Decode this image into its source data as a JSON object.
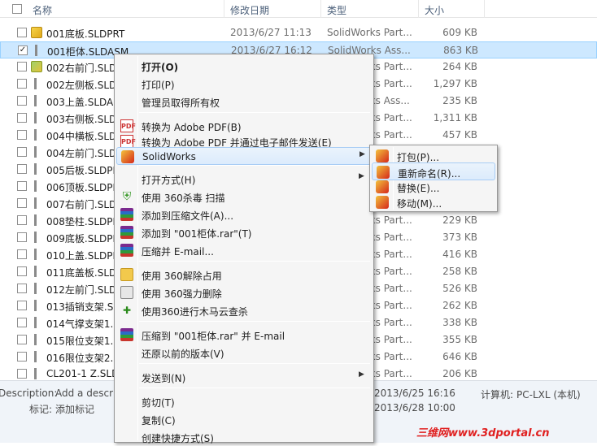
{
  "header": {
    "name": "名称",
    "date": "修改日期",
    "type": "类型",
    "size": "大小"
  },
  "files": [
    {
      "name": "001底板.SLDPRT",
      "date": "2013/6/27 11:13",
      "type": "SolidWorks Part...",
      "size": "609 KB",
      "icon": "part-icon"
    },
    {
      "name": "001柜体.SLDASM",
      "date": "2013/6/27 16:12",
      "type": "SolidWorks Ass...",
      "size": "863 KB",
      "icon": "drawing-icon",
      "selected": true,
      "check": "✓"
    },
    {
      "name": "002右前门.SLD",
      "date": "",
      "type": "SolidWorks Part...",
      "size": "264 KB",
      "icon": "assembly-icon"
    },
    {
      "name": "002左侧板.SLD",
      "date": "",
      "type": "SolidWorks Part...",
      "size": "1,297 KB",
      "icon": "drawing-icon"
    },
    {
      "name": "003上盖.SLDAS",
      "date": "",
      "type": "SolidWorks Ass...",
      "size": "235 KB",
      "icon": "drawing-icon"
    },
    {
      "name": "003右侧板.SLD",
      "date": "",
      "type": "SolidWorks Part...",
      "size": "1,311 KB",
      "icon": "drawing-icon"
    },
    {
      "name": "004中横板.SLD",
      "date": "",
      "type": "SolidWorks Part...",
      "size": "457 KB",
      "icon": "drawing-icon"
    },
    {
      "name": "004左前门.SLD",
      "date": "",
      "type": "",
      "size": "",
      "icon": "drawing-icon"
    },
    {
      "name": "005后板.SLDPF",
      "date": "",
      "type": "",
      "size": "",
      "icon": "drawing-icon"
    },
    {
      "name": "006顶板.SLDPF",
      "date": "",
      "type": "",
      "size": "",
      "icon": "drawing-icon"
    },
    {
      "name": "007右前门.SLD",
      "date": "",
      "type": "",
      "size": "",
      "icon": "drawing-icon"
    },
    {
      "name": "008垫柱.SLDPF",
      "date": "",
      "type": "SolidWorks Part...",
      "size": "229 KB",
      "icon": "drawing-icon"
    },
    {
      "name": "009底板.SLDPF",
      "date": "",
      "type": "SolidWorks Part...",
      "size": "373 KB",
      "icon": "drawing-icon"
    },
    {
      "name": "010上盖.SLDPF",
      "date": "",
      "type": "SolidWorks Part...",
      "size": "416 KB",
      "icon": "drawing-icon"
    },
    {
      "name": "011底盖板.SLD",
      "date": "",
      "type": "SolidWorks Part...",
      "size": "258 KB",
      "icon": "drawing-icon"
    },
    {
      "name": "012左前门.SLD",
      "date": "",
      "type": "SolidWorks Part...",
      "size": "526 KB",
      "icon": "drawing-icon"
    },
    {
      "name": "013插销支架.SL",
      "date": "",
      "type": "SolidWorks Part...",
      "size": "262 KB",
      "icon": "drawing-icon"
    },
    {
      "name": "014气撑支架1.S",
      "date": "",
      "type": "SolidWorks Part...",
      "size": "338 KB",
      "icon": "drawing-icon"
    },
    {
      "name": "015限位支架1.S",
      "date": "",
      "type": "SolidWorks Part...",
      "size": "355 KB",
      "icon": "drawing-icon"
    },
    {
      "name": "016限位支架2.S",
      "date": "",
      "type": "SolidWorks Part...",
      "size": "646 KB",
      "icon": "drawing-icon"
    },
    {
      "name": "CL201-1 Z.SLD",
      "date": "",
      "type": "SolidWorks Part...",
      "size": "206 KB",
      "icon": "drawing-icon"
    }
  ],
  "status": {
    "description_label": "Description:",
    "description_value": "Add a descr",
    "tags_label": "标记:",
    "tags_value": "添加标记",
    "date1": "2013/6/25 16:16",
    "date2": "2013/6/28 10:00",
    "computer_label": "计算机:",
    "computer_value": "PC-LXL (本机)"
  },
  "context_menu": [
    {
      "label": "打开(O)",
      "icon": "",
      "bold": true
    },
    {
      "label": "打印(P)",
      "icon": ""
    },
    {
      "label": "管理员取得所有权",
      "icon": ""
    },
    {
      "label": "转换为 Adobe PDF(B)",
      "icon": "pdf-icon"
    },
    {
      "label": "转换为 Adobe PDF 并通过电子邮件发送(E)",
      "icon": "pdf-icon"
    },
    {
      "label": "SolidWorks",
      "icon": "solidworks-icon",
      "submenu": true,
      "highlighted": true
    },
    {
      "label": "打开方式(H)",
      "icon": "",
      "submenu": true
    },
    {
      "label": "使用 360杀毒 扫描",
      "icon": "shield-icon"
    },
    {
      "label": "添加到压缩文件(A)...",
      "icon": "winrar-icon"
    },
    {
      "label": "添加到 \"001柜体.rar\"(T)",
      "icon": "winrar-icon"
    },
    {
      "label": "压缩并 E-mail...",
      "icon": "winrar-icon"
    },
    {
      "label": "使用 360解除占用",
      "icon": "unlock-icon"
    },
    {
      "label": "使用 360强力删除",
      "icon": "shredder-icon"
    },
    {
      "label": "使用360进行木马云查杀",
      "icon": "360-plus-icon"
    },
    {
      "label": "压缩到 \"001柜体.rar\" 并 E-mail",
      "icon": "winrar-icon"
    },
    {
      "label": "还原以前的版本(V)",
      "icon": ""
    },
    {
      "label": "发送到(N)",
      "icon": "",
      "submenu": true
    },
    {
      "label": "剪切(T)",
      "icon": ""
    },
    {
      "label": "复制(C)",
      "icon": ""
    },
    {
      "label": "创建快捷方式(S)",
      "icon": ""
    }
  ],
  "submenu": [
    {
      "label": "打包(P)...",
      "icon": "solidworks-icon"
    },
    {
      "label": "重新命名(R)...",
      "icon": "solidworks-icon",
      "highlighted": true
    },
    {
      "label": "替换(E)...",
      "icon": "solidworks-icon"
    },
    {
      "label": "移动(M)...",
      "icon": "solidworks-icon"
    }
  ],
  "arrow_glyph": "▶",
  "watermark": "三维网www.3dportal.cn"
}
